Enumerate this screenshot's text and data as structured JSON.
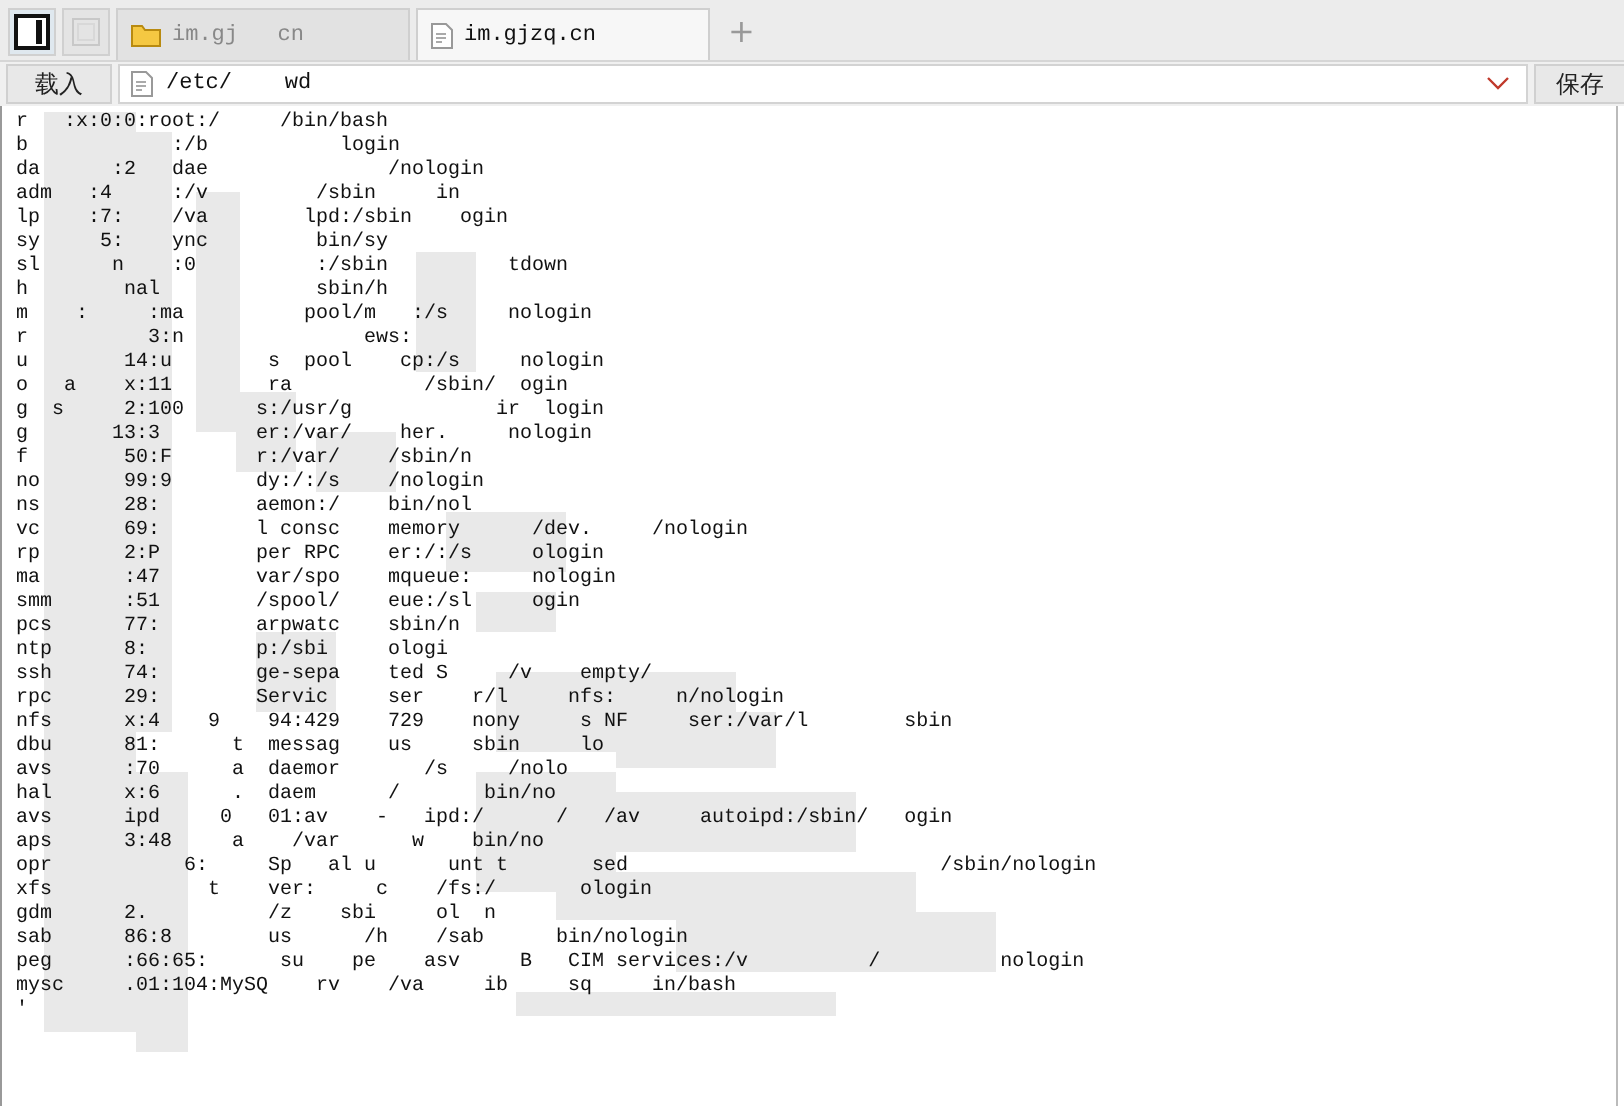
{
  "tabs": [
    {
      "label": "im.gj   cn",
      "kind": "folder",
      "selected": false
    },
    {
      "label": "im.gjzq.cn",
      "kind": "file",
      "selected": true
    }
  ],
  "new_tab": "+",
  "toolbar": {
    "load_button": "载入",
    "path": "/etc/    wd",
    "save_button": "保存"
  },
  "content": {
    "lines": [
      "r   :x:0:0:root:/     /bin/bash",
      "b            :/b           login",
      "da      :2   dae               /nologin",
      "adm   :4     :/v         /sbin     in",
      "lp    :7:    /va        lpd:/sbin    ogin",
      "sy     5:    ync         bin/sy",
      "sl      n    :0          :/sbin          tdown",
      "h        nal             sbin/h",
      "m    :     :ma          pool/m   :/s     nologin",
      "r          3:n               ews:",
      "u        14:u        s  pool    cp:/s     nologin",
      "o   a    x:11        ra           /sbin/  ogin",
      "g  s     2:100      s:/usr/g            ir  login",
      "g       13:3        er:/var/    her.     nologin",
      "f        50:F       r:/var/    /sbin/n",
      "no       99:9       dy:/:/s    /nologin",
      "ns       28:        aemon:/    bin/nol",
      "vc       69:        l consc    memory      /dev.     /nologin",
      "rp       2:P        per RPC    er:/:/s     ologin",
      "ma       :47        var/spo    mqueue:     nologin",
      "smm      :51        /spool/    eue:/sl     ogin",
      "pcs      77:        arpwatc    sbin/n",
      "ntp      8:         p:/sbi     ologi",
      "ssh      74:        ge-sepa    ted S     /v    empty/",
      "rpc      29:        Servic     ser    r/l     nfs:     n/nologin",
      "nfs      x:4    9    94:429    729    nony     s NF     ser:/var/l        sbin",
      "dbu      81:      t  messag    us     sbin     lo",
      "avs      :70      a  daemor       /s     /nolo",
      "hal      x:6      .  daem      /       bin/no",
      "avs      ipd     0   01:av    -   ipd:/      /   /av     autoipd:/sbin/   ogin",
      "aps      3:48     a    /var      w    bin/no",
      "opr           6:     Sp   al u      unt t       sed                          /sbin/nologin",
      "xfs             t    ver:     c    /fs:/       ologin",
      "gdm      2.          /z    sbi     ol  n",
      "sab      86:8        us      /h    /sab      bin/nologin",
      "peg      :66:65:      su    pe    asv     B   CIM services:/v          /          nologin",
      "mysc     .01:104:MySQ    rv    /va     ib     sq     in/bash",
      "'"
    ]
  }
}
